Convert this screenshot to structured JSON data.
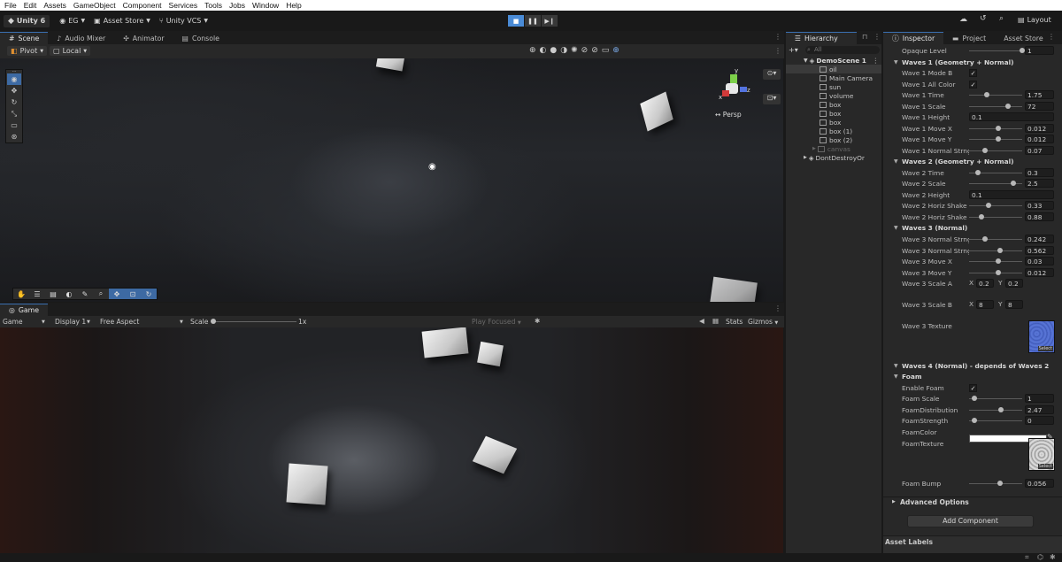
{
  "menubar": [
    "File",
    "Edit",
    "Assets",
    "GameObject",
    "Component",
    "Services",
    "Tools",
    "Jobs",
    "Window",
    "Help"
  ],
  "toolbar": {
    "unity_label": "Unity 6",
    "account_label": "EG",
    "asset_store_label": "Asset Store",
    "vcs_label": "Unity VCS",
    "layout_label": "Layout"
  },
  "scene_tabs": [
    "Scene",
    "Audio Mixer",
    "Animator",
    "Console"
  ],
  "scene_toolbar": {
    "pivot": "Pivot",
    "local": "Local",
    "persp": "Persp"
  },
  "game": {
    "tab": "Game",
    "mode": "Game",
    "display": "Display 1",
    "aspect": "Free Aspect",
    "scale_label": "Scale",
    "scale_value": "1x",
    "play_focused": "Play Focused",
    "stats": "Stats",
    "gizmos": "Gizmos"
  },
  "hierarchy": {
    "tab": "Hierarchy",
    "search_placeholder": "All",
    "scene": "DemoScene 1",
    "items": [
      "oil",
      "Main Camera",
      "sun",
      "volume",
      "box",
      "box",
      "box",
      "box (1)",
      "box (2)",
      "canvas"
    ],
    "dont_destroy": "DontDestroyOr"
  },
  "inspector": {
    "tabs": [
      "Inspector",
      "Project",
      "Asset Store"
    ],
    "opaque_label": "Opaque Level",
    "opaque_value": "1",
    "waves1_header": "Waves 1 (Geometry + Normal)",
    "w1_mode_b": "Wave 1 Mode B",
    "w1_all_color": "Wave 1 All Color",
    "w1_time": "Wave 1 Time",
    "w1_time_v": "1.75",
    "w1_scale": "Wave 1 Scale",
    "w1_scale_v": "72",
    "w1_height": "Wave 1 Height",
    "w1_height_v": "0.1",
    "w1_movex": "Wave 1 Move X",
    "w1_movex_v": "0.012",
    "w1_movey": "Wave 1 Move Y",
    "w1_movey_v": "0.012",
    "w1_normal": "Wave 1 Normal Strng",
    "w1_normal_v": "0.07",
    "waves2_header": "Waves 2 (Geometry + Normal)",
    "w2_time": "Wave 2 Time",
    "w2_time_v": "0.3",
    "w2_scale": "Wave 2 Scale",
    "w2_scale_v": "2.5",
    "w2_height": "Wave 2 Height",
    "w2_height_v": "0.1",
    "w2_hshake1": "Wave 2 Horiz Shake",
    "w2_hshake1_v": "0.33",
    "w2_hshake2": "Wave 2 Horiz Shake",
    "w2_hshake2_v": "0.88",
    "waves3_header": "Waves 3 (Normal)",
    "w3_normal1": "Wave 3 Normal Strng",
    "w3_normal1_v": "0.242",
    "w3_normal2": "Wave 3 Normal Strng",
    "w3_normal2_v": "0.562",
    "w3_movex": "Wave 3 Move X",
    "w3_movex_v": "0.03",
    "w3_movey": "Wave 3 Move Y",
    "w3_movey_v": "0.012",
    "w3_scale_a": "Wave 3 Scale A",
    "w3_scale_a_x": "0.2",
    "w3_scale_a_y": "0.2",
    "w3_scale_b": "Wave 3 Scale B",
    "w3_scale_b_x": "8",
    "w3_scale_b_y": "8",
    "w3_texture": "Wave 3 Texture",
    "select": "Select",
    "waves4_header": "Waves 4 (Normal) - depends of Waves 2",
    "foam_header": "Foam",
    "enable_foam": "Enable Foam",
    "foam_scale": "Foam Scale",
    "foam_scale_v": "1",
    "foam_dist": "FoamDistribution",
    "foam_dist_v": "2.47",
    "foam_strength": "FoamStrength",
    "foam_strength_v": "0",
    "foam_color": "FoamColor",
    "foam_texture": "FoamTexture",
    "foam_bump": "Foam Bump",
    "foam_bump_v": "0.056",
    "advanced": "Advanced Options",
    "add_component": "Add Component",
    "asset_labels": "Asset Labels"
  },
  "axis_labels": {
    "x": "x",
    "y": "y",
    "z": "z"
  },
  "slider_levels": {
    "opaque": 1.0,
    "w1_time": 0.3,
    "w1_scale": 0.72,
    "w1_movex": 0.52,
    "w1_movey": 0.52,
    "w1_normal": 0.27,
    "w2_time": 0.12,
    "w2_scale": 0.82,
    "w2_hshake1": 0.33,
    "w2_hshake2": 0.2,
    "w3_normal1": 0.27,
    "w3_normal2": 0.56,
    "w3_movex": 0.52,
    "w3_movey": 0.52,
    "foam_scale": 0.05,
    "foam_dist": 0.58,
    "foam_strength": 0.05,
    "foam_bump": 0.56
  },
  "colors": {
    "accent": "#3d6aa3",
    "play_active": "#4a8bd6",
    "texture_blue": "#4c66c9"
  }
}
